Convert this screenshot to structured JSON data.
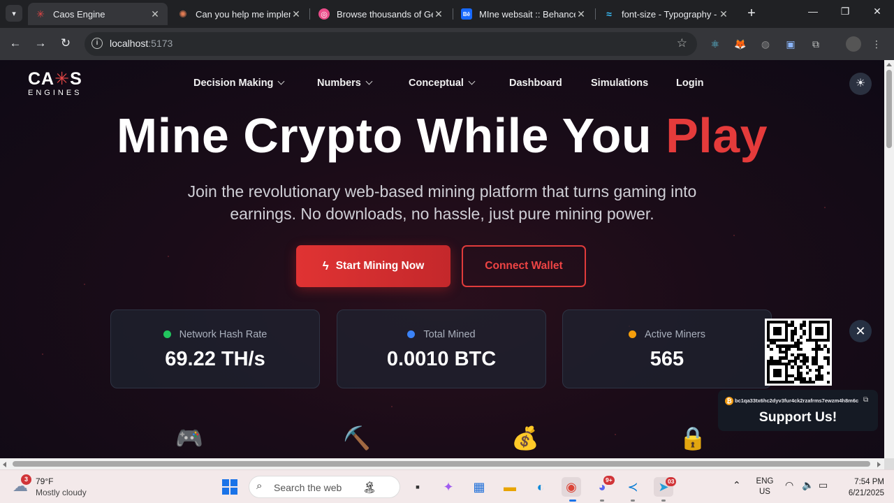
{
  "browser": {
    "tabs": [
      {
        "title": "Caos Engine",
        "favicon": "caos-red-icon",
        "color": "#e04545",
        "active": true
      },
      {
        "title": "Can you help me implem",
        "favicon": "claude-icon",
        "color": "#e07b53",
        "active": false
      },
      {
        "title": "Browse thousands of Ger",
        "favicon": "dribbble-icon",
        "color": "#ea4c89",
        "active": false
      },
      {
        "title": "MIne websait :: Behance",
        "favicon": "behance-icon",
        "color": "#1769ff",
        "active": false
      },
      {
        "title": "font-size - Typography -",
        "favicon": "tailwind-icon",
        "color": "#38bdf8",
        "active": false
      }
    ],
    "url_host": "localhost",
    "url_port": ":5173"
  },
  "site": {
    "logo_main": "CA",
    "logo_spark": "✳",
    "logo_main_end": "S",
    "logo_sub": "ENGINES",
    "nav": [
      {
        "label": "Decision Making",
        "dropdown": true
      },
      {
        "label": "Numbers",
        "dropdown": true
      },
      {
        "label": "Conceptual",
        "dropdown": true
      },
      {
        "label": "Dashboard",
        "dropdown": false
      },
      {
        "label": "Simulations",
        "dropdown": false
      },
      {
        "label": "Login",
        "dropdown": false
      }
    ],
    "hero": {
      "title_main": "Mine Crypto While You ",
      "title_accent": "Play",
      "subtitle": "Join the revolutionary web-based mining platform that turns gaming into earnings. No downloads, no hassle, just pure mining power."
    },
    "buttons": {
      "primary": "Start Mining Now",
      "secondary": "Connect Wallet"
    },
    "stats": [
      {
        "label": "Network Hash Rate",
        "value": "69.22 TH/s",
        "dot_color": "#22c55e"
      },
      {
        "label": "Total Mined",
        "value": "0.0010 BTC",
        "dot_color": "#3b82f6"
      },
      {
        "label": "Active Miners",
        "value": "565",
        "dot_color": "#f59e0b"
      }
    ],
    "features": [
      {
        "icon": "🎮",
        "name": "gamepad-icon"
      },
      {
        "icon": "⛏️",
        "name": "pickaxe-icon"
      },
      {
        "icon": "💰",
        "name": "money-bag-icon"
      },
      {
        "icon": "🔒",
        "name": "lock-icon"
      }
    ],
    "support": {
      "address": "bc1qa33tx6hc2dyv3fur4ck2rzafrms7ewzm4h8m6c",
      "title": "Support Us!"
    },
    "colors": {
      "accent": "#e53b3b",
      "background": "#120b16"
    }
  },
  "taskbar": {
    "weather_badge": "3",
    "temperature": "79°F",
    "condition": "Mostly cloudy",
    "search_placeholder": "Search the web",
    "discord_badge": "9+",
    "telegram_badge": "03",
    "lang_top": "ENG",
    "lang_bottom": "US",
    "time": "7:54 PM",
    "date": "6/21/2025"
  }
}
